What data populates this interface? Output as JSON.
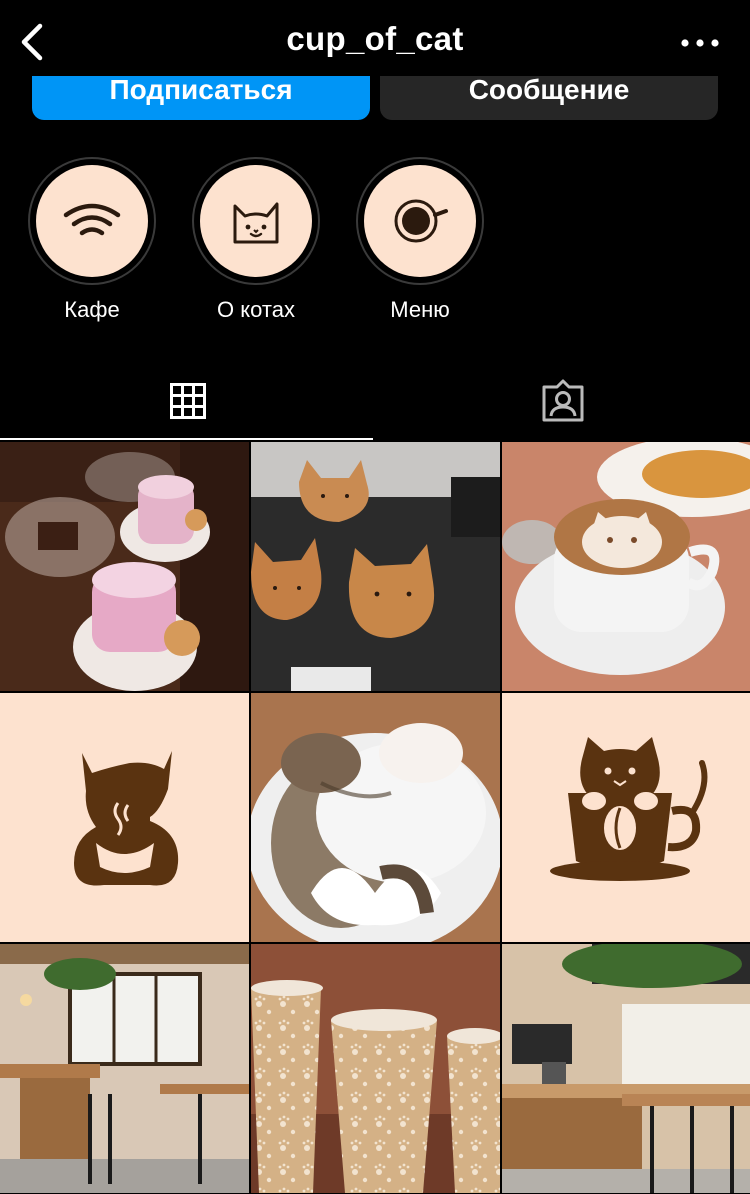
{
  "header": {
    "username": "cup_of_cat",
    "back_icon": "chevron-left-icon",
    "more_icon": "more-horizontal-icon"
  },
  "actions": {
    "follow_label": "Подписаться",
    "message_label": "Сообщение"
  },
  "highlights": [
    {
      "label": "Кафе",
      "icon": "wifi-icon"
    },
    {
      "label": "О котах",
      "icon": "cat-face-icon"
    },
    {
      "label": "Меню",
      "icon": "coffee-cup-icon"
    }
  ],
  "tabs": [
    {
      "name": "posts-grid",
      "icon": "grid-icon",
      "active": true
    },
    {
      "name": "tagged",
      "icon": "tagged-person-icon",
      "active": false
    }
  ],
  "colors": {
    "accent": "#0095f6",
    "background": "#000000",
    "highlight_fill": "#fde2cf",
    "brand_brown": "#5a3310",
    "message_button": "#262626"
  },
  "posts": [
    {
      "subject": "pink lattes with cat cookies"
    },
    {
      "subject": "cat-shaped pastries"
    },
    {
      "subject": "cat latte art"
    },
    {
      "subject": "cat coffee logo"
    },
    {
      "subject": "two sleeping cats"
    },
    {
      "subject": "cat in cup logo"
    },
    {
      "subject": "cafe interior"
    },
    {
      "subject": "paw print paper cups"
    },
    {
      "subject": "cafe counter interior"
    }
  ]
}
